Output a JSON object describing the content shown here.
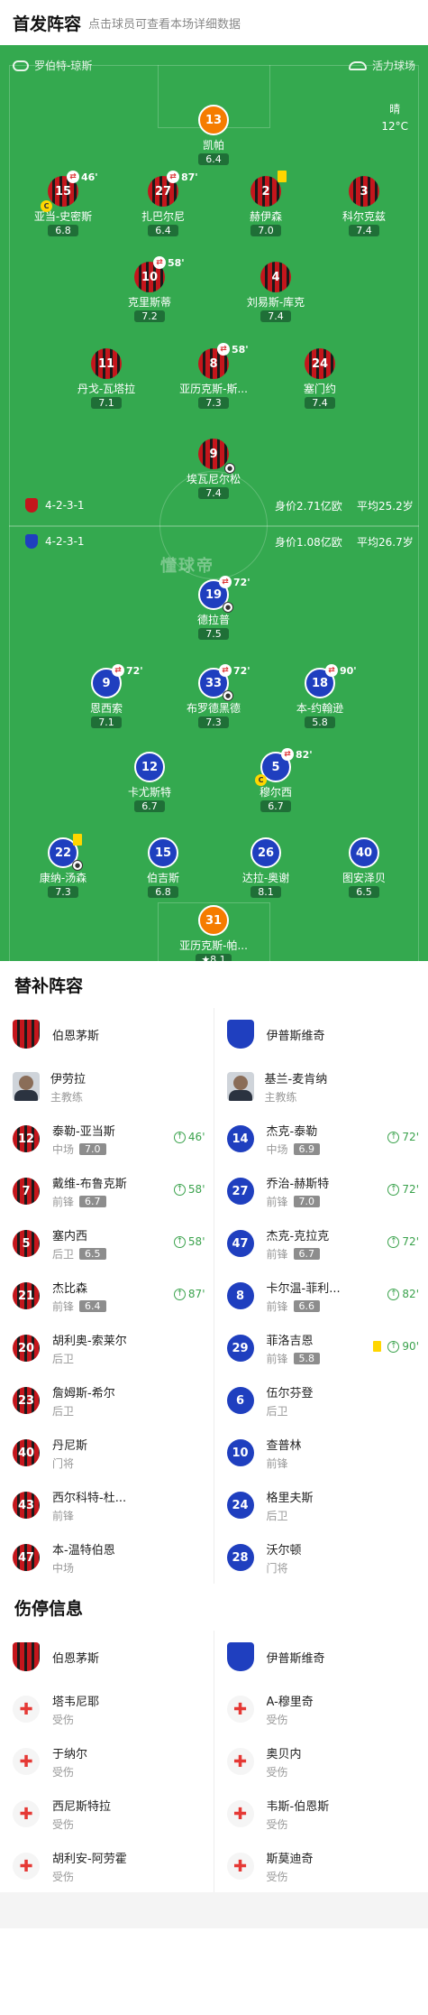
{
  "header": {
    "title": "首发阵容",
    "subtitle": "点击球员可查看本场详细数据"
  },
  "teams": {
    "home": "罗伯特-琼斯",
    "away": "活力球场"
  },
  "weather": {
    "condition": "晴",
    "temp": "12°C"
  },
  "home_formation": {
    "formation": "4-2-3-1",
    "value": "身价2.71亿欧",
    "age": "平均25.2岁"
  },
  "away_formation": {
    "formation": "4-2-3-1",
    "value": "身价1.08亿欧",
    "age": "平均26.7岁"
  },
  "watermark": "懂球帝",
  "home_players": [
    {
      "num": "13",
      "name": "凯帕",
      "rating": "6.4",
      "kit": "gk1"
    },
    {
      "num": "15",
      "name": "亚当-史密斯",
      "rating": "6.8",
      "kit": "red",
      "sub": "46'",
      "captain": "C"
    },
    {
      "num": "27",
      "name": "扎巴尔尼",
      "rating": "6.4",
      "kit": "red",
      "sub": "87'"
    },
    {
      "num": "2",
      "name": "赫伊森",
      "rating": "7.0",
      "kit": "red",
      "card": true
    },
    {
      "num": "3",
      "name": "科尔克兹",
      "rating": "7.4",
      "kit": "red"
    },
    {
      "num": "10",
      "name": "克里斯蒂",
      "rating": "7.2",
      "kit": "red",
      "sub": "58'"
    },
    {
      "num": "4",
      "name": "刘易斯-库克",
      "rating": "7.4",
      "kit": "red"
    },
    {
      "num": "11",
      "name": "丹戈-瓦塔拉",
      "rating": "7.1",
      "kit": "red"
    },
    {
      "num": "8",
      "name": "亚历克斯-斯...",
      "rating": "7.3",
      "kit": "red",
      "sub": "58'"
    },
    {
      "num": "24",
      "name": "塞门约",
      "rating": "7.4",
      "kit": "red"
    },
    {
      "num": "9",
      "name": "埃瓦尼尔松",
      "rating": "7.4",
      "kit": "red",
      "goal": true
    }
  ],
  "away_players": [
    {
      "num": "19",
      "name": "德拉普",
      "rating": "7.5",
      "kit": "blue",
      "sub": "72'",
      "goal": true
    },
    {
      "num": "9",
      "name": "恩西索",
      "rating": "7.1",
      "kit": "blue",
      "sub": "72'"
    },
    {
      "num": "33",
      "name": "布罗德黑德",
      "rating": "7.3",
      "kit": "blue",
      "sub": "72'",
      "goal": true
    },
    {
      "num": "18",
      "name": "本-约翰逊",
      "rating": "5.8",
      "kit": "blue",
      "sub": "90'"
    },
    {
      "num": "12",
      "name": "卡尤斯特",
      "rating": "6.7",
      "kit": "blue"
    },
    {
      "num": "5",
      "name": "穆尔西",
      "rating": "6.7",
      "kit": "blue",
      "sub": "82'",
      "captain": "C"
    },
    {
      "num": "22",
      "name": "康纳-汤森",
      "rating": "7.3",
      "kit": "blue",
      "card": true,
      "ball": true
    },
    {
      "num": "15",
      "name": "伯吉斯",
      "rating": "6.8",
      "kit": "blue"
    },
    {
      "num": "26",
      "name": "达拉-奥谢",
      "rating": "8.1",
      "kit": "blue"
    },
    {
      "num": "40",
      "name": "图安泽贝",
      "rating": "6.5",
      "kit": "blue"
    },
    {
      "num": "31",
      "name": "亚历克斯-帕...",
      "rating": "8.1",
      "kit": "gk1",
      "best": true
    }
  ],
  "subs_title": "替补阵容",
  "subs_home_team": "伯恩茅斯",
  "subs_away_team": "伊普斯维奇",
  "coach_home": {
    "name": "伊劳拉",
    "role": "主教练"
  },
  "coach_away": {
    "name": "基兰-麦肯纳",
    "role": "主教练"
  },
  "subs_home": [
    {
      "num": "12",
      "name": "泰勒-亚当斯",
      "pos": "中场",
      "rating": "7.0",
      "in": "46'"
    },
    {
      "num": "7",
      "name": "戴维-布鲁克斯",
      "pos": "前锋",
      "rating": "6.7",
      "in": "58'"
    },
    {
      "num": "5",
      "name": "塞内西",
      "pos": "后卫",
      "rating": "6.5",
      "in": "58'"
    },
    {
      "num": "21",
      "name": "杰比森",
      "pos": "前锋",
      "rating": "6.4",
      "in": "87'"
    },
    {
      "num": "20",
      "name": "胡利奥-索莱尔",
      "pos": "后卫"
    },
    {
      "num": "23",
      "name": "詹姆斯-希尔",
      "pos": "后卫"
    },
    {
      "num": "40",
      "name": "丹尼斯",
      "pos": "门将"
    },
    {
      "num": "43",
      "name": "西尔科特-杜...",
      "pos": "前锋"
    },
    {
      "num": "47",
      "name": "本-温特伯恩",
      "pos": "中场"
    }
  ],
  "subs_away": [
    {
      "num": "14",
      "name": "杰克-泰勒",
      "pos": "中场",
      "rating": "6.9",
      "in": "72'"
    },
    {
      "num": "27",
      "name": "乔治-赫斯特",
      "pos": "前锋",
      "rating": "7.0",
      "in": "72'"
    },
    {
      "num": "47",
      "name": "杰克-克拉克",
      "pos": "前锋",
      "rating": "6.7",
      "in": "72'"
    },
    {
      "num": "8",
      "name": "卡尔温-菲利...",
      "pos": "前锋",
      "rating": "6.6",
      "in": "82'"
    },
    {
      "num": "29",
      "name": "菲洛吉恩",
      "pos": "前锋",
      "rating": "5.8",
      "in": "90'",
      "card": true
    },
    {
      "num": "6",
      "name": "伍尔芬登",
      "pos": "后卫"
    },
    {
      "num": "10",
      "name": "查普林",
      "pos": "前锋"
    },
    {
      "num": "24",
      "name": "格里夫斯",
      "pos": "后卫"
    },
    {
      "num": "28",
      "name": "沃尔顿",
      "pos": "门将"
    }
  ],
  "injury_title": "伤停信息",
  "injury_home": [
    {
      "name": "塔韦尼耶",
      "status": "受伤"
    },
    {
      "name": "于纳尔",
      "status": "受伤"
    },
    {
      "name": "西尼斯特拉",
      "status": "受伤"
    },
    {
      "name": "胡利安-阿劳霍",
      "status": "受伤"
    }
  ],
  "injury_away": [
    {
      "name": "A-穆里奇",
      "status": "受伤"
    },
    {
      "name": "奥贝内",
      "status": "受伤"
    },
    {
      "name": "韦斯-伯恩斯",
      "status": "受伤"
    },
    {
      "name": "斯莫迪奇",
      "status": "受伤"
    }
  ],
  "colors": {
    "pitch": "#34a94f",
    "home_red": "#c4161c",
    "away_blue": "#1f3fbf",
    "gk": "#f57c00",
    "sub_green": "#3aa24c"
  },
  "icons": {
    "sub": "sub-off-icon",
    "captain": "captain-icon",
    "card": "yellow-card-icon",
    "goal": "ball-icon",
    "injury": "medical-cross-icon"
  }
}
